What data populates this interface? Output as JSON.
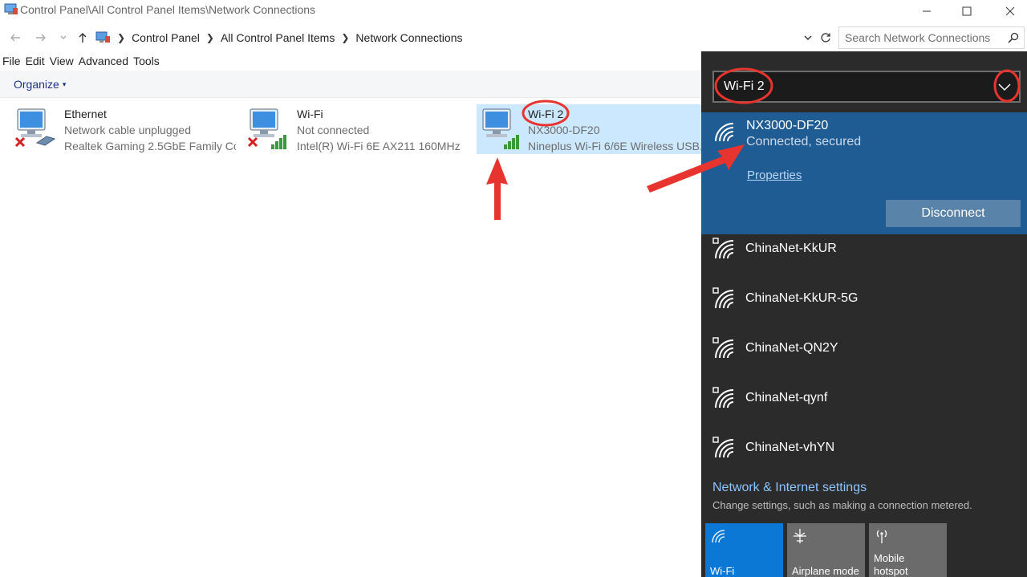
{
  "window": {
    "title": "Control Panel\\All Control Panel Items\\Network Connections"
  },
  "address": {
    "crumbs": [
      "Control Panel",
      "All Control Panel Items",
      "Network Connections"
    ]
  },
  "search": {
    "placeholder": "Search Network Connections"
  },
  "menu": {
    "file": "File",
    "edit": "Edit",
    "view": "View",
    "advanced": "Advanced",
    "tools": "Tools"
  },
  "command": {
    "organize": "Organize"
  },
  "adapters": [
    {
      "name": "Ethernet",
      "status": "Network cable unplugged",
      "device": "Realtek Gaming 2.5GbE Family Co..."
    },
    {
      "name": "Wi-Fi",
      "status": "Not connected",
      "device": "Intel(R) Wi-Fi 6E AX211 160MHz"
    },
    {
      "name": "Wi-Fi 2",
      "status": "NX3000-DF20",
      "device": "Nineplus Wi-Fi 6/6E Wireless USB..."
    }
  ],
  "flyout": {
    "adapter_selected": "Wi-Fi 2",
    "connected": {
      "ssid": "NX3000-DF20",
      "state": "Connected, secured",
      "properties": "Properties",
      "disconnect": "Disconnect"
    },
    "networks": [
      "ChinaNet-KkUR",
      "ChinaNet-KkUR-5G",
      "ChinaNet-QN2Y",
      "ChinaNet-qynf",
      "ChinaNet-vhYN"
    ],
    "settings_link": "Network & Internet settings",
    "settings_desc": "Change settings, such as making a connection metered.",
    "tiles": {
      "wifi": "Wi-Fi",
      "airplane": "Airplane mode",
      "hotspot_1": "Mobile",
      "hotspot_2": "hotspot"
    }
  },
  "colors": {
    "flyout_bg": "#2b2b2b",
    "connected_bg": "#1e5c93",
    "selected_item": "#cce8ff",
    "annotation_red": "#e8342e",
    "link_blue": "#8cc4ff"
  }
}
